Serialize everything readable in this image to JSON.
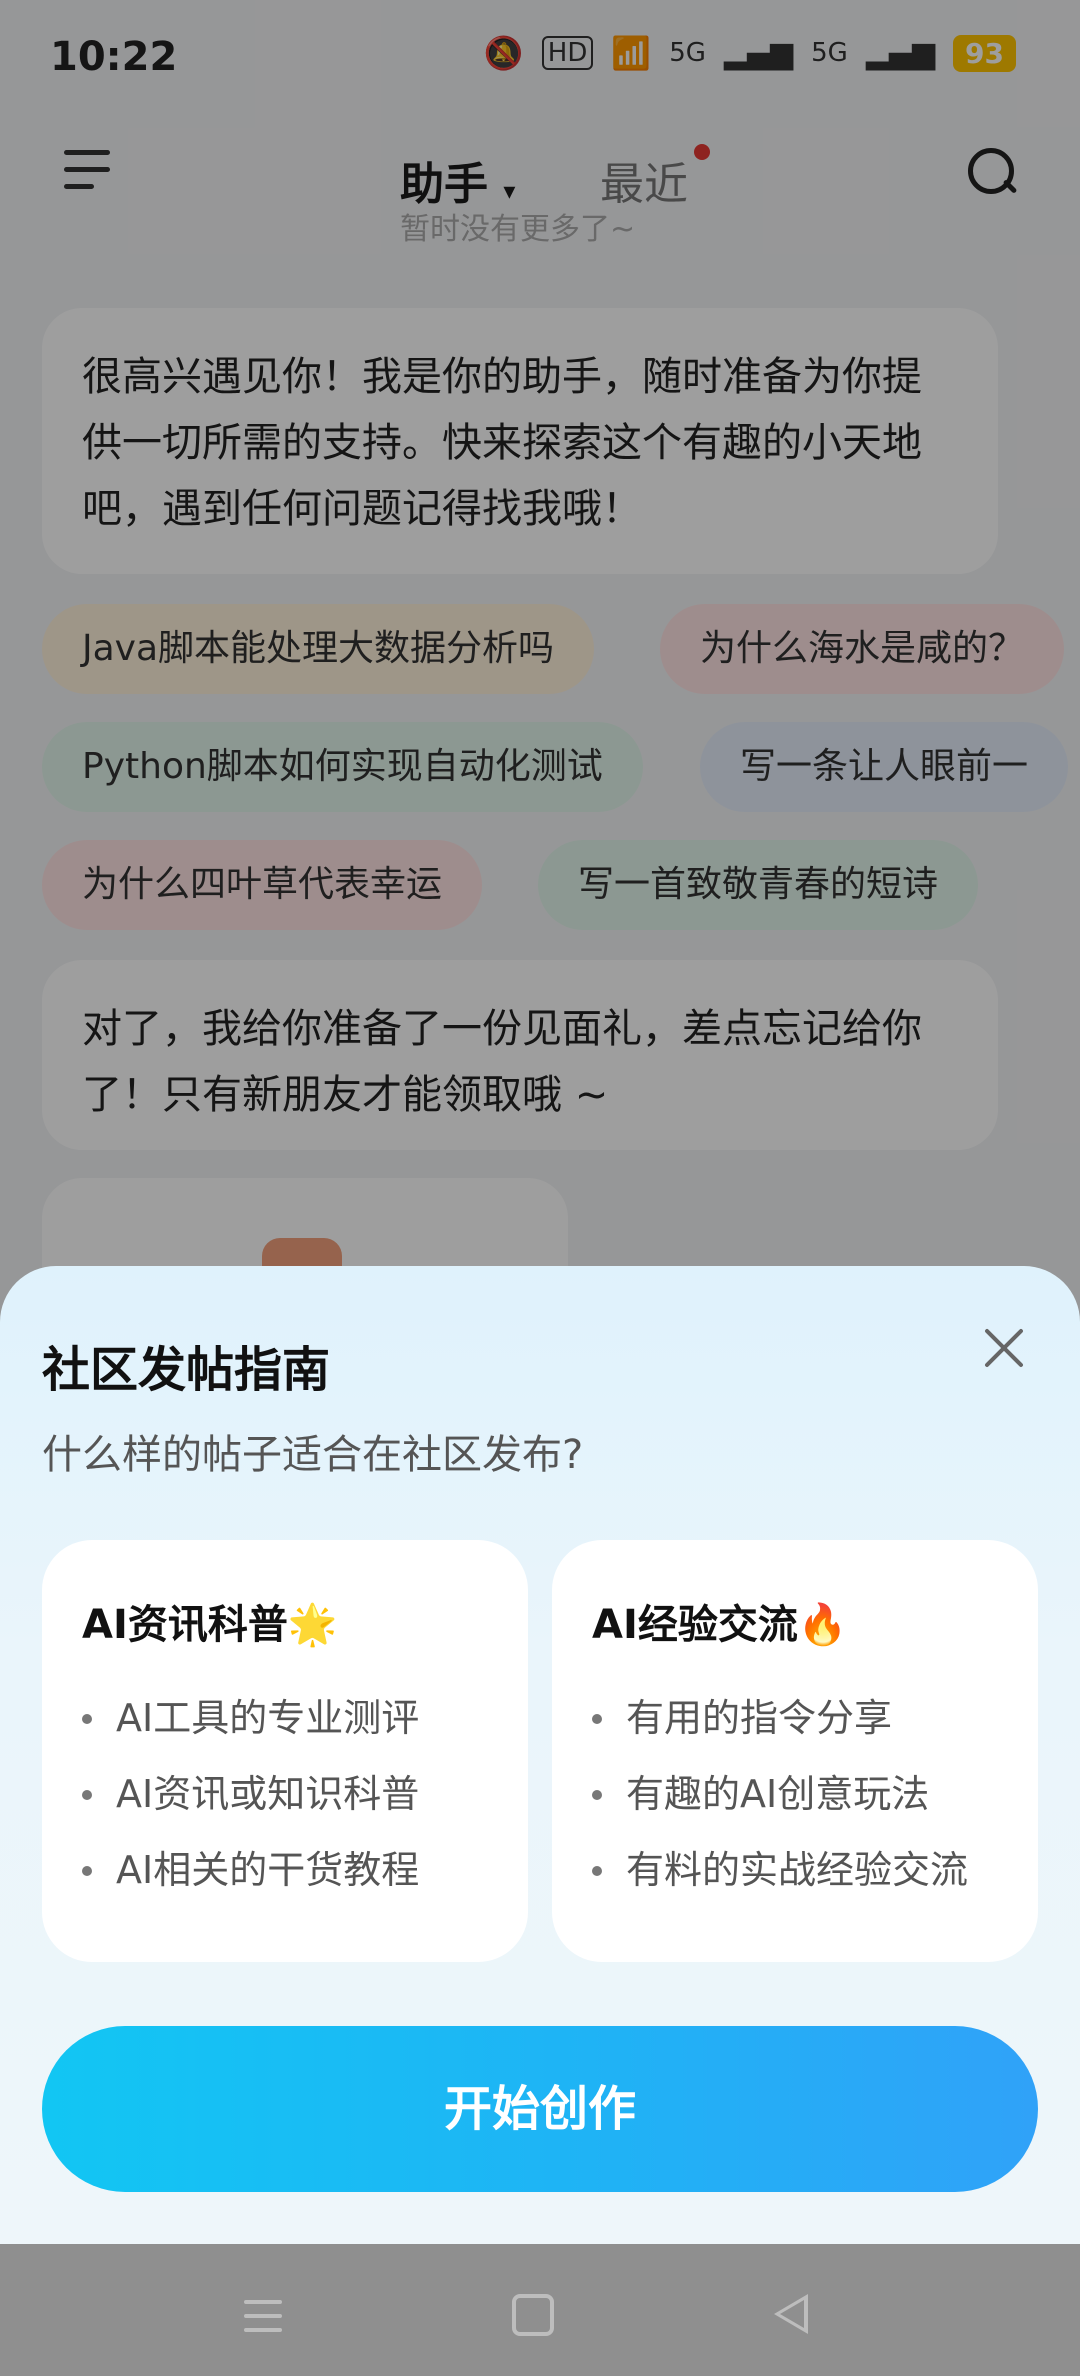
{
  "status_bar": {
    "time": "10:22",
    "network_hd": "HD",
    "network_5g_1": "5G",
    "network_5g_2": "5G",
    "battery": "93",
    "icons": [
      "mute-bell-icon",
      "wifi-icon",
      "signal-icon",
      "battery-icon"
    ]
  },
  "nav": {
    "tab_assistant": "助手",
    "tab_recent": "最近",
    "menu_icon": "menu-icon",
    "search_icon": "search-icon"
  },
  "chat": {
    "no_more": "暂时没有更多了~",
    "greeting": "很高兴遇见你！我是你的助手，随时准备为你提供一切所需的支持。快来探索这个有趣的小天地吧，遇到任何问题记得找我哦！",
    "suggestions": [
      "Java脚本能处理大数据分析吗",
      "为什么海水是咸的？",
      "Python脚本如何实现自动化测试",
      "写一条让人眼前一",
      "为什么四叶草代表幸运",
      "写一首致敬青春的短诗"
    ],
    "gift_message": "对了，我给你准备了一份见面礼，差点忘记给你了！只有新朋友才能领取哦 ~"
  },
  "sheet": {
    "title": "社区发帖指南",
    "subtitle": "什么样的帖子适合在社区发布?",
    "cards": [
      {
        "title": "AI资讯科普🌟",
        "items": [
          "AI工具的专业测评",
          "AI资讯或知识科普",
          "AI相关的干货教程"
        ]
      },
      {
        "title": "AI经验交流🔥",
        "items": [
          "有用的指令分享",
          "有趣的AI创意玩法",
          "有料的实战经验交流"
        ]
      }
    ],
    "cta": "开始创作",
    "close_icon": "close-icon"
  },
  "system_nav": {
    "icons": [
      "recent-apps-icon",
      "home-icon",
      "back-icon"
    ]
  },
  "colors": {
    "cta_start": "#12c6f3",
    "cta_end": "#30a2f8",
    "battery": "#ffc400",
    "badge": "#e53935"
  }
}
